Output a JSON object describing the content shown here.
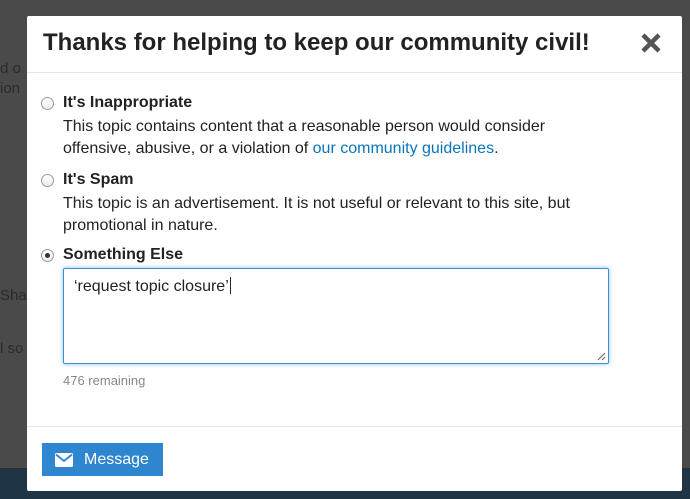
{
  "background": {
    "fragments": [
      "d o",
      "ion",
      "Shar",
      "l so"
    ]
  },
  "modal": {
    "title": "Thanks for helping to keep our community civil!",
    "close_icon": "close-icon",
    "options": [
      {
        "title": "It's Inappropriate",
        "description_before": "This topic contains content that a reasonable person would consider offensive, abusive, or a violation of ",
        "link_text": "our community guidelines",
        "description_after": ".",
        "checked": false
      },
      {
        "title": "It's Spam",
        "description": "This topic is an advertisement. It is not useful or relevant to this site, but promotional in nature.",
        "checked": false
      },
      {
        "title": "Something Else",
        "checked": true
      }
    ],
    "textarea_value": "‘request topic closure’",
    "remaining": "476 remaining",
    "message_button": {
      "label": "Message",
      "icon": "envelope-icon"
    }
  },
  "colors": {
    "accent": "#2f86d0",
    "link": "#0b75b9",
    "focus_border": "#3a8edb"
  }
}
